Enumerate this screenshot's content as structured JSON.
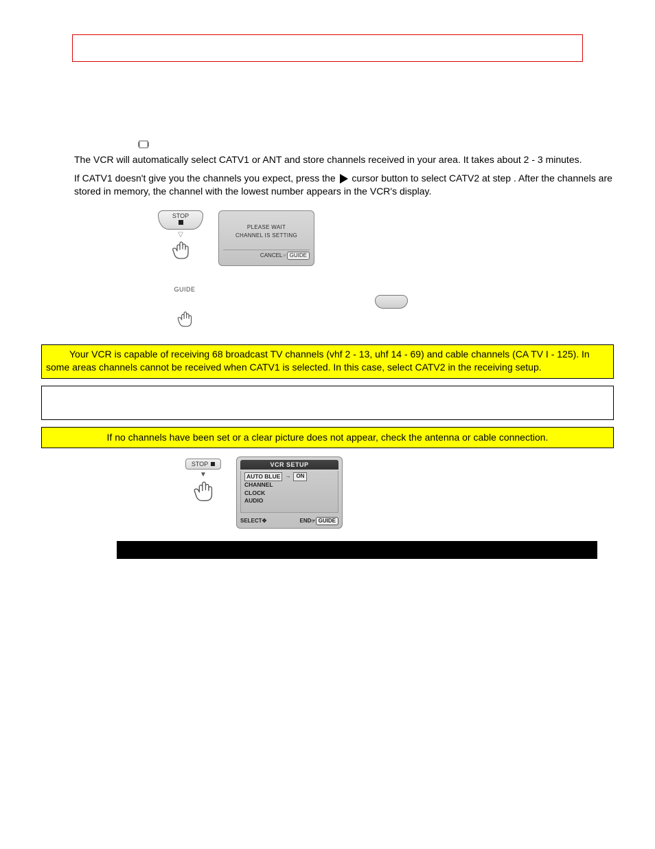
{
  "body": {
    "p1": "The VCR will automatically select CATV1 or ANT and store channels received in your area. It takes about 2 - 3 minutes.",
    "p2a": "If CATV1 doesn't give you the channels you expect, press the ",
    "p2b": " cursor button to select CATV2 at step   . After the channels are stored in memory, the channel with the lowest number appears in the VCR's display."
  },
  "fig_stop": {
    "label": "STOP"
  },
  "fig_lcd": {
    "line1": "PLEASE WAIT",
    "line2": "CHANNEL IS SETTING",
    "footer_left": "CANCEL",
    "footer_btn": "GUIDE"
  },
  "fig_guide": {
    "label": "GUIDE"
  },
  "note1": {
    "text": "Your VCR is capable of receiving 68 broadcast TV channels (vhf 2 - 13, uhf 14 - 69) and cable channels (CA TV I - 125). In some areas channels cannot be received when CATV1 is selected.  In this case, select CATV2 in the receiving setup."
  },
  "note2": {
    "text": "If no channels have been set or a clear picture does not appear, check the antenna or cable connection."
  },
  "fig_stop2": {
    "label": "STOP"
  },
  "fig_setup": {
    "title": "VCR SETUP",
    "row1_left": "AUTO BLUE",
    "row1_right": "ON",
    "row2": "CHANNEL",
    "row3": "CLOCK",
    "row4": "AUDIO",
    "foot_left": "SELECT",
    "foot_end": "END",
    "foot_btn": "GUIDE"
  }
}
